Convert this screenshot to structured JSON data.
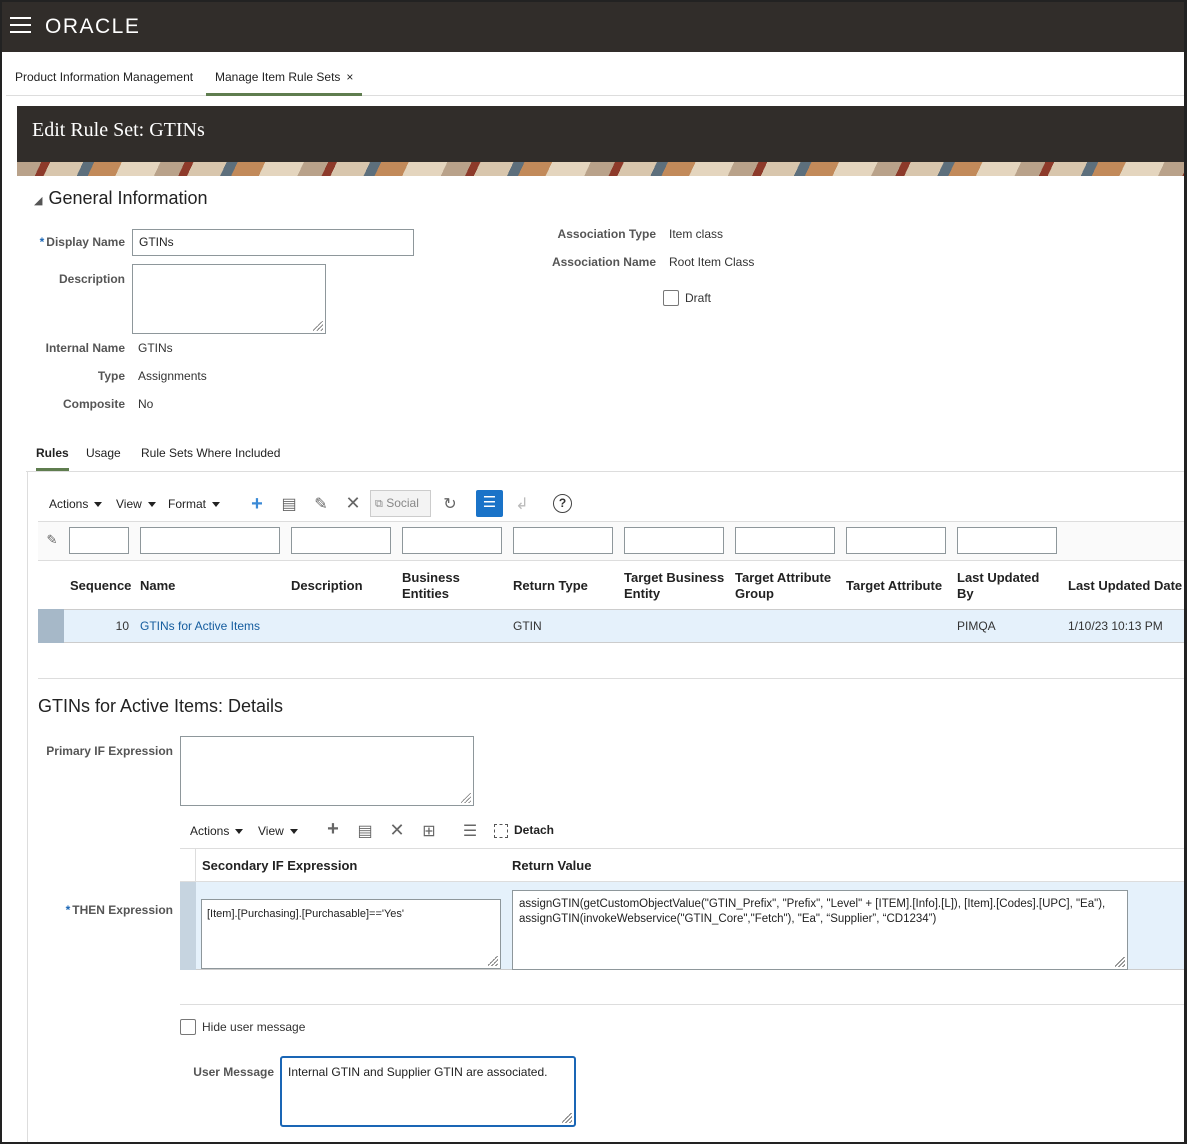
{
  "app": {
    "logo": "ORACLE"
  },
  "tabs": [
    {
      "label": "Product Information Management"
    },
    {
      "label": "Manage Item Rule Sets",
      "close": "×"
    }
  ],
  "page": {
    "title": "Edit Rule Set: GTINs"
  },
  "general": {
    "section_title": "General Information",
    "display_name_label": "Display Name",
    "display_name_value": "GTINs",
    "description_label": "Description",
    "description_value": "",
    "internal_name_label": "Internal Name",
    "internal_name_value": "GTINs",
    "type_label": "Type",
    "type_value": "Assignments",
    "composite_label": "Composite",
    "composite_value": "No",
    "association_type_label": "Association Type",
    "association_type_value": "Item class",
    "association_name_label": "Association Name",
    "association_name_value": "Root Item Class",
    "draft_label": "Draft",
    "draft_checked": false
  },
  "subtabs": [
    {
      "label": "Rules"
    },
    {
      "label": "Usage"
    },
    {
      "label": "Rule Sets Where Included"
    }
  ],
  "rules_toolbar": {
    "actions": "Actions",
    "view": "View",
    "format": "Format",
    "social": "Social",
    "help": "?"
  },
  "rules_table": {
    "columns": [
      "Sequence",
      "Name",
      "Description",
      "Business Entities",
      "Return Type",
      "Target Business Entity",
      "Target Attribute Group",
      "Target Attribute",
      "Last Updated By",
      "Last Updated Date"
    ],
    "rows": [
      {
        "sequence": "10",
        "name": "GTINs for Active Items",
        "description": "",
        "business_entities": "",
        "return_type": "GTIN",
        "target_business_entity": "",
        "target_attribute_group": "",
        "target_attribute": "",
        "last_updated_by": "PIMQA",
        "last_updated_date": "1/10/23 10:13 PM"
      }
    ]
  },
  "details": {
    "title": "GTINs for Active Items: Details",
    "primary_if_label": "Primary IF Expression",
    "primary_if_value": "",
    "toolbar": {
      "actions": "Actions",
      "view": "View",
      "detach": "Detach"
    },
    "columns": [
      "Secondary IF Expression",
      "Return Value"
    ],
    "then_label": "THEN Expression",
    "secondary_if_value": "[Item].[Purchasing].[Purchasable]=='Yes'",
    "return_value": "assignGTIN(getCustomObjectValue(\"GTIN_Prefix\", \"Prefix\", \"Level\" + [ITEM].[Info].[L]), [Item].[Codes].[UPC], \"Ea\"), assignGTIN(invokeWebservice(\"GTIN_Core\",\"Fetch\"), \"Ea\", “Supplier”, “CD1234”)",
    "hide_user_message_label": "Hide user message",
    "hide_user_message_checked": false,
    "user_message_label": "User Message",
    "user_message_value": "Internal GTIN and Supplier GTIN are associated."
  },
  "colors": {
    "topbar": "#312d2a",
    "accent": "#5f7d4f",
    "link": "#145c9e",
    "selected_row": "#e5f1fb",
    "primary_button": "#1a73c8"
  }
}
